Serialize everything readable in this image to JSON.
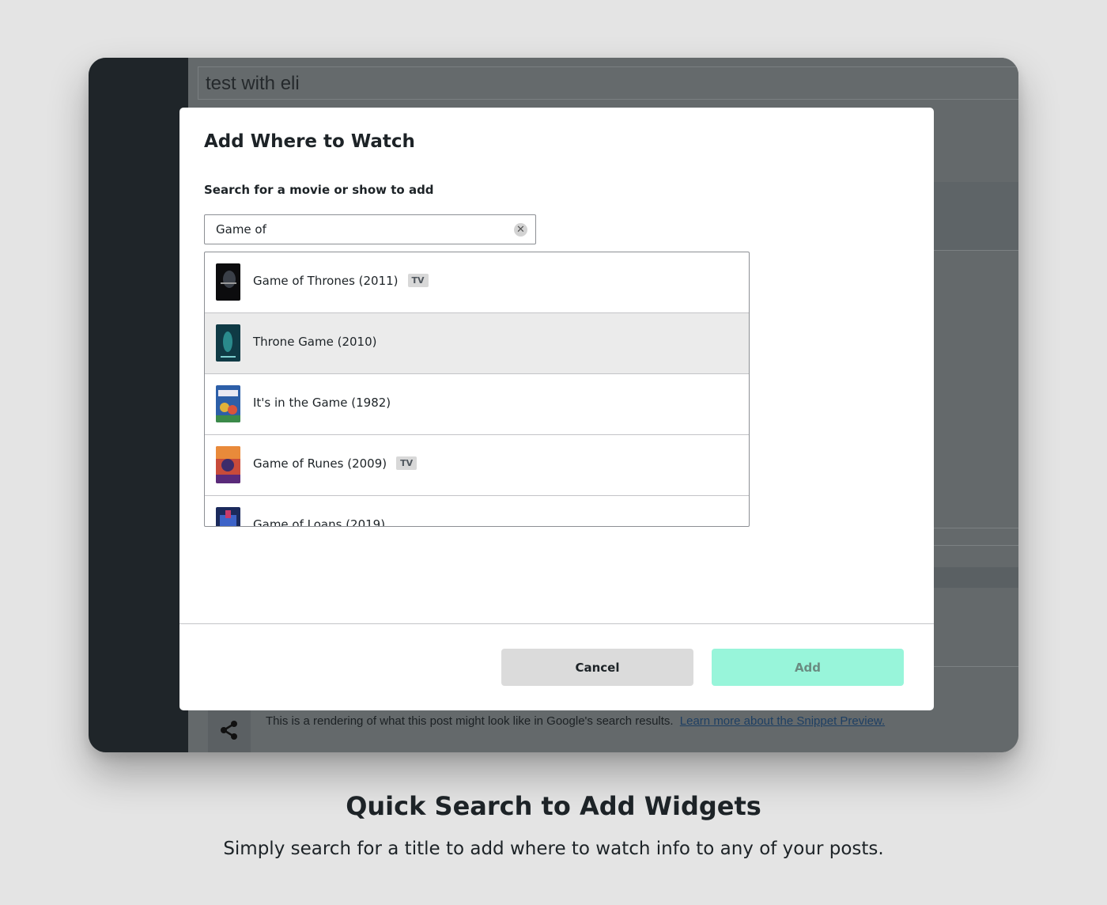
{
  "editor": {
    "post_title": "test with eli",
    "snippet_text": "This is a rendering of what this post might look like in Google's search results.",
    "snippet_link": "Learn more about the Snippet Preview."
  },
  "modal": {
    "title": "Add Where to Watch",
    "search_label": "Search for a movie or show to add",
    "search_value": "Game of",
    "results": [
      {
        "title": "Game of Thrones (2011)",
        "badge": "TV",
        "poster": "poster-dark"
      },
      {
        "title": "Throne Game (2010)",
        "badge": "",
        "poster": "poster-teal",
        "selected": true
      },
      {
        "title": "It's in the Game (1982)",
        "badge": "",
        "poster": "poster-colorful"
      },
      {
        "title": "Game of Runes (2009)",
        "badge": "TV",
        "poster": "poster-warm"
      },
      {
        "title": "Game of Loans (2019)",
        "badge": "",
        "poster": "poster-blue"
      }
    ],
    "cancel_label": "Cancel",
    "add_label": "Add"
  },
  "caption": {
    "title": "Quick Search to Add Widgets",
    "subtitle": "Simply search for a title to add where to watch info to any of your posts."
  },
  "colors": {
    "accent_add": "#98f5da",
    "cancel": "#dbdbdb",
    "sidebar": "#1f2529"
  }
}
